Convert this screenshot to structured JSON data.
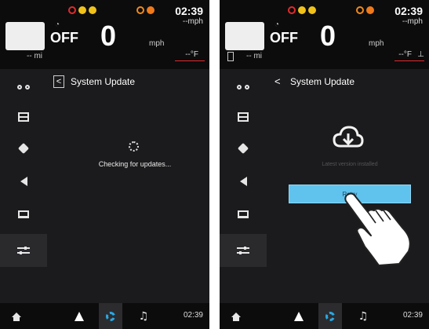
{
  "status": {
    "time": "02:39",
    "speed_unit_top": "--mph",
    "off_label": "OFF",
    "speed_value": "0",
    "speed_unit": "mph",
    "range": "-- mi",
    "temperature": "--°F"
  },
  "header": {
    "back_glyph": "<",
    "title": "System Update"
  },
  "left_screen": {
    "checking_text": "Checking for updates..."
  },
  "right_screen": {
    "latest_text": "Latest version installed",
    "retry_label": "Retry"
  },
  "sidebar": {
    "items": [
      {
        "icon": "motorcycle-icon"
      },
      {
        "icon": "dashboard-icon"
      },
      {
        "icon": "satellite-icon"
      },
      {
        "icon": "speaker-icon"
      },
      {
        "icon": "display-icon"
      },
      {
        "icon": "settings-sliders-icon",
        "selected": true
      }
    ]
  },
  "bottom_nav": {
    "items": [
      "home-icon",
      "navigation-icon",
      "settings-icon",
      "music-icon"
    ],
    "selected": "settings-icon",
    "time": "02:39"
  },
  "colors": {
    "background": "#1b1b1d",
    "accent_blue": "#29a9e4",
    "retry_button": "#5fc3ee",
    "warning_red": "#e02b2b",
    "warning_amber": "#f0c21a"
  }
}
